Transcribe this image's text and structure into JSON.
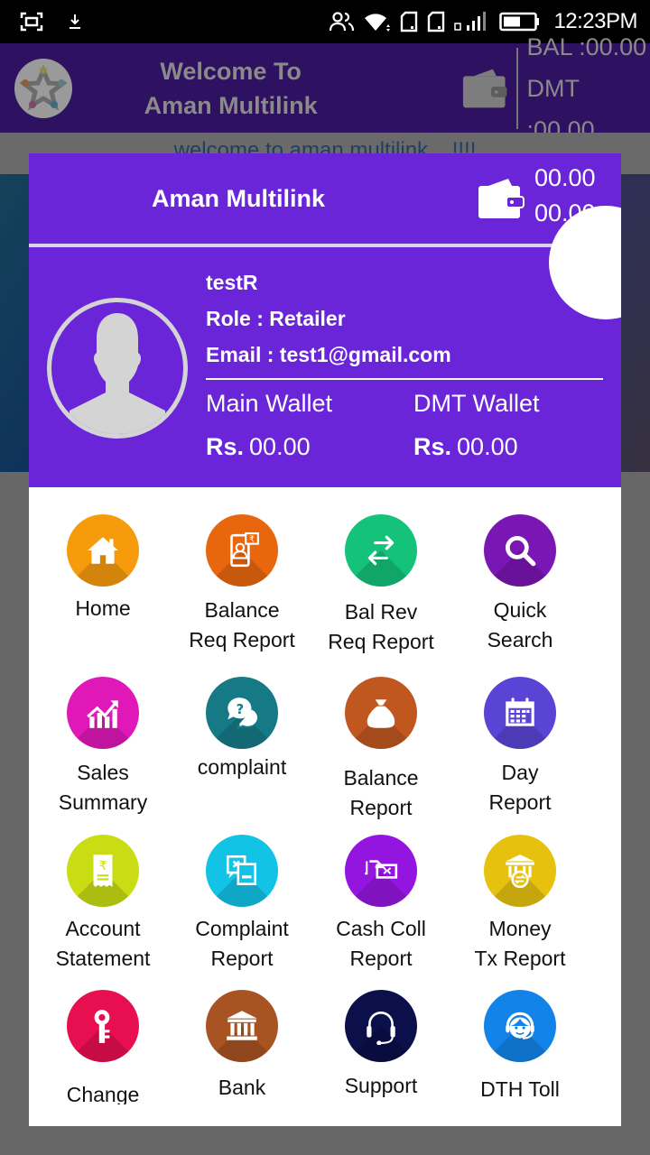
{
  "status_bar": {
    "time": "12:23PM",
    "icons": [
      "screenshot-icon",
      "download-icon",
      "contacts-icon",
      "wifi-icon",
      "sim1-icon",
      "sim2-icon",
      "signal-icon",
      "battery-icon"
    ]
  },
  "app_bar": {
    "title_line1": "Welcome To",
    "title_line2": "Aman Multilink",
    "bal_label": "BAL  :00.00",
    "dmt_label": "DMT :00.00"
  },
  "marquee": "welcome to aman multilink....!!!!",
  "dialog": {
    "title": "Aman Multilink",
    "wallet_amount_1": "00.00",
    "wallet_amount_2": "00.00",
    "profile": {
      "name": "testR",
      "role": "Role : Retailer",
      "email": "Email : test1@gmail.com",
      "main_wallet_label": "Main Wallet",
      "dmt_wallet_label": "DMT Wallet",
      "currency": "Rs.",
      "main_wallet_value": "00.00",
      "dmt_wallet_value": "00.00"
    },
    "menu": [
      {
        "label": "Home",
        "icon": "home-icon",
        "color": "#f59b0c"
      },
      {
        "label": "Balance\nReq Report",
        "icon": "balance-request-icon",
        "color": "#e8670e"
      },
      {
        "label": "Bal Rev\nReq Report",
        "icon": "transfer-arrows-icon",
        "color": "#14c27a"
      },
      {
        "label": "Quick\nSearch",
        "icon": "search-icon",
        "color": "#7a16b3"
      },
      {
        "label": "Sales\nSummary",
        "icon": "sales-chart-icon",
        "color": "#e018b8"
      },
      {
        "label": "complaint",
        "icon": "question-chat-icon",
        "color": "#167a86"
      },
      {
        "label": "Balance\nReport",
        "icon": "money-bag-icon",
        "color": "#c0571f"
      },
      {
        "label": "Day\nReport",
        "icon": "calendar-icon",
        "color": "#5a44d6"
      },
      {
        "label": "Account\nStatement",
        "icon": "receipt-icon",
        "color": "#c9dc14"
      },
      {
        "label": "Complaint\nReport",
        "icon": "complaint-report-icon",
        "color": "#12c3e6"
      },
      {
        "label": "Cash Coll\nReport",
        "icon": "cash-collection-icon",
        "color": "#9515e0"
      },
      {
        "label": "Money\nTx Report",
        "icon": "bank-transfer-icon",
        "color": "#e6c20e"
      },
      {
        "label": "Change\nPassword",
        "icon": "key-icon",
        "color": "#e80f50"
      },
      {
        "label": "Bank\nAccount",
        "icon": "bank-icon",
        "color": "#a85322"
      },
      {
        "label": "Support",
        "icon": "headset-icon",
        "color": "#0b0f4a"
      },
      {
        "label": "DTH Toll\nFree",
        "icon": "agent-icon",
        "color": "#1283e8"
      }
    ]
  }
}
